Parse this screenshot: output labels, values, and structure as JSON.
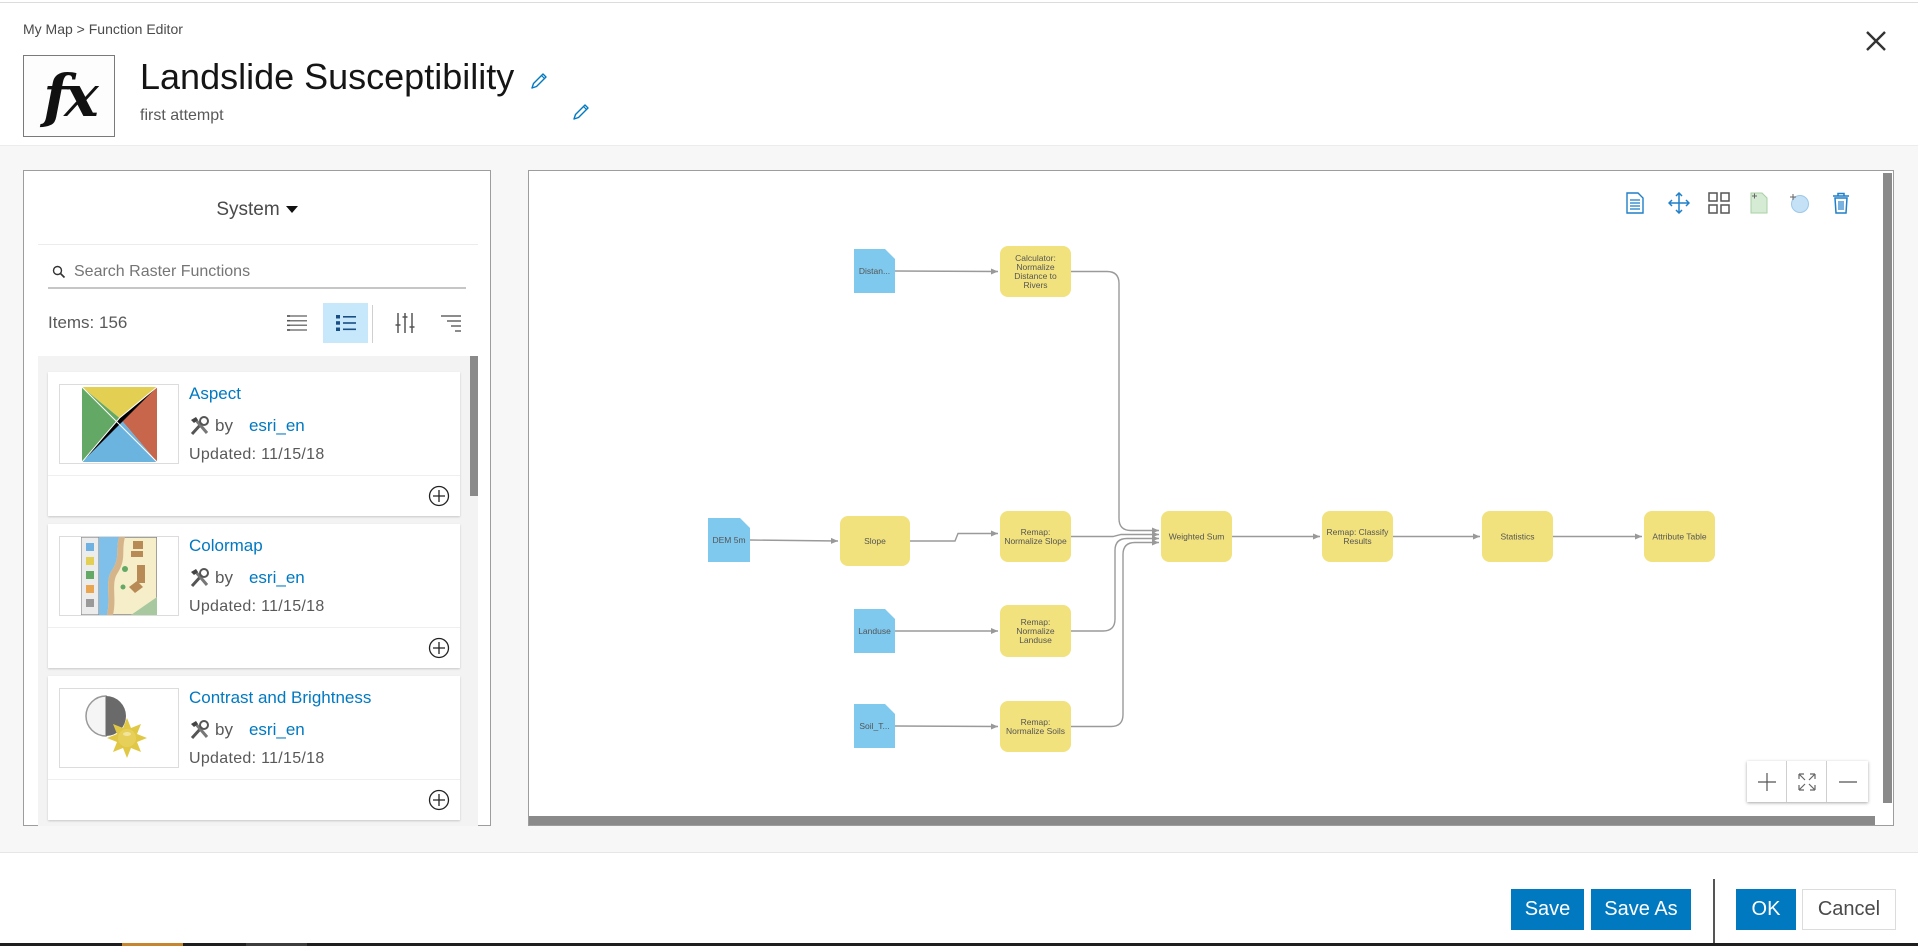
{
  "header": {
    "breadcrumb": "My Map > Function Editor",
    "icon": "fx-function-icon",
    "icon_text": "fx",
    "title": "Landslide Susceptibility",
    "description": "first attempt"
  },
  "left_panel": {
    "source_dropdown": "System",
    "search_placeholder": "Search Raster Functions",
    "search_value": "",
    "items_count_label": "Items: 156",
    "view_modes": [
      {
        "name": "compact-list",
        "active": false
      },
      {
        "name": "detailed-list",
        "active": true
      }
    ],
    "tool_buttons": [
      "filter-icon",
      "sort-icon"
    ],
    "items": [
      {
        "name": "Aspect",
        "by_label": "by",
        "owner": "esri_en",
        "updated": "Updated: 11/15/18",
        "thumbnail": "aspect-thumbnail"
      },
      {
        "name": "Colormap",
        "by_label": "by",
        "owner": "esri_en",
        "updated": "Updated: 11/15/18",
        "thumbnail": "colormap-thumbnail"
      },
      {
        "name": "Contrast and Brightness",
        "by_label": "by",
        "owner": "esri_en",
        "updated": "Updated: 11/15/18",
        "thumbnail": "contrast-brightness-thumbnail"
      }
    ]
  },
  "canvas": {
    "toolbar": [
      "properties-icon",
      "move-icon",
      "auto-layout-icon",
      "add-raster-variable-icon",
      "add-scalar-variable-icon",
      "delete-icon"
    ],
    "colors": {
      "input": "#7fc8ee",
      "function": "#f2e27d",
      "edge": "#9a9a9a"
    },
    "nodes": [
      {
        "id": "distance",
        "type": "input",
        "label": "Distan..."
      },
      {
        "id": "calc",
        "type": "function",
        "label": "Calculator: Normalize Distance to Rivers"
      },
      {
        "id": "dem",
        "type": "input",
        "label": "DEM 5m"
      },
      {
        "id": "slope",
        "type": "function",
        "label": "Slope"
      },
      {
        "id": "remap_slope",
        "type": "function",
        "label": "Remap: Normalize Slope"
      },
      {
        "id": "wsum",
        "type": "function",
        "label": "Weighted Sum"
      },
      {
        "id": "classify",
        "type": "function",
        "label": "Remap: Classify Results"
      },
      {
        "id": "stats",
        "type": "function",
        "label": "Statistics"
      },
      {
        "id": "attr",
        "type": "function",
        "label": "Attribute Table"
      },
      {
        "id": "landuse",
        "type": "input",
        "label": "Landuse"
      },
      {
        "id": "remap_landuse",
        "type": "function",
        "label": "Remap: Normalize Landuse"
      },
      {
        "id": "soil",
        "type": "input",
        "label": "Soil_T..."
      },
      {
        "id": "remap_soils",
        "type": "function",
        "label": "Remap: Normalize Soils"
      }
    ],
    "edges": [
      [
        "distance",
        "calc"
      ],
      [
        "dem",
        "slope"
      ],
      [
        "slope",
        "remap_slope"
      ],
      [
        "landuse",
        "remap_landuse"
      ],
      [
        "soil",
        "remap_soils"
      ],
      [
        "calc",
        "wsum"
      ],
      [
        "remap_slope",
        "wsum"
      ],
      [
        "remap_landuse",
        "wsum"
      ],
      [
        "remap_soils",
        "wsum"
      ],
      [
        "wsum",
        "classify"
      ],
      [
        "classify",
        "stats"
      ],
      [
        "stats",
        "attr"
      ]
    ],
    "zoom_controls": [
      "zoom-in-icon",
      "zoom-to-fit-icon",
      "zoom-out-icon"
    ]
  },
  "footer": {
    "save": "Save",
    "save_as": "Save As",
    "ok": "OK",
    "cancel": "Cancel"
  }
}
